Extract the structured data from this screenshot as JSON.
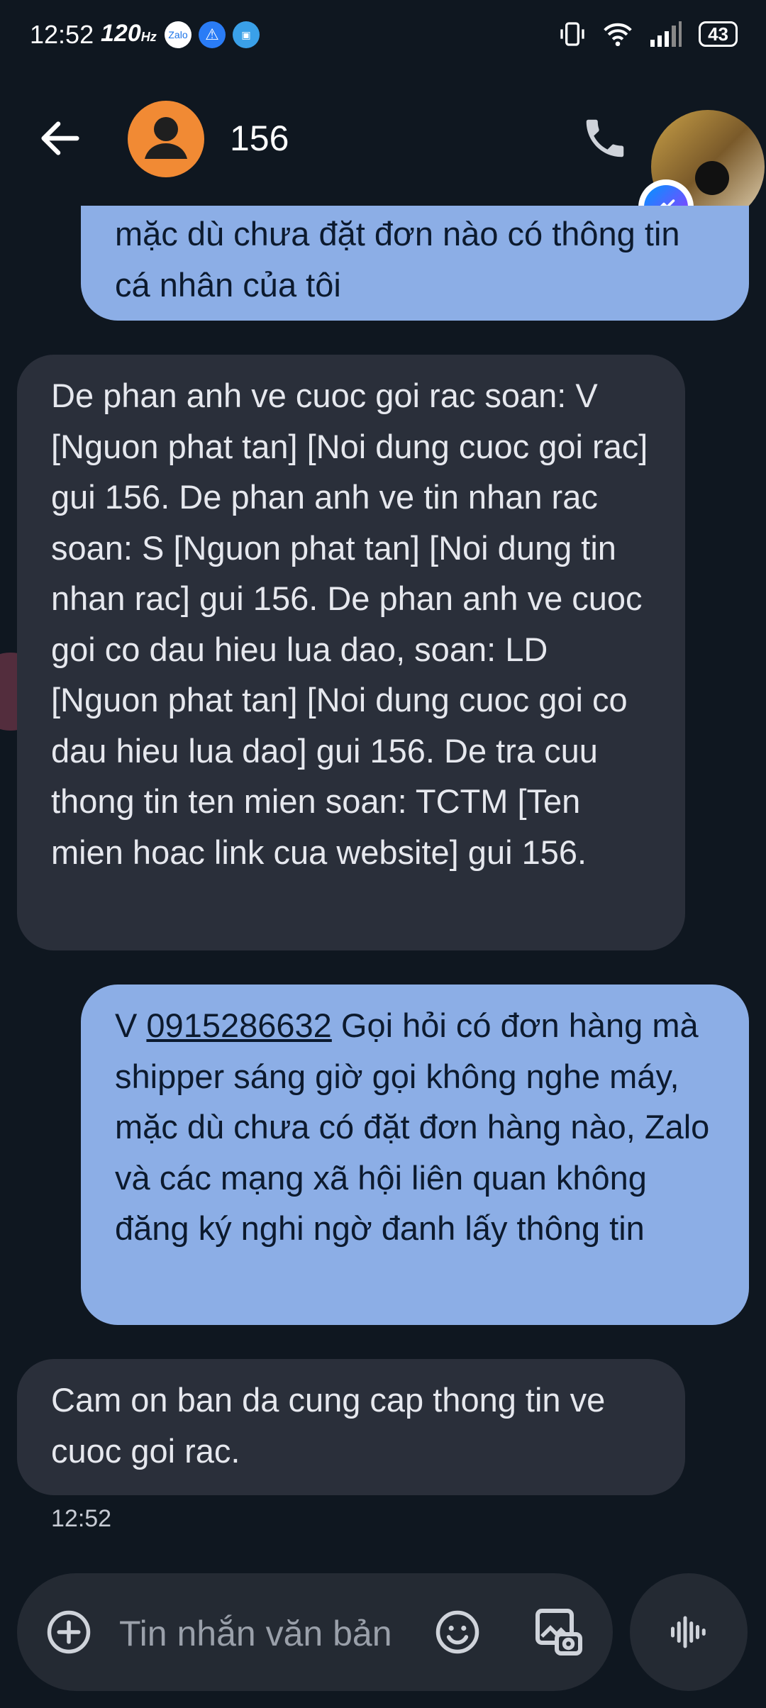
{
  "status_bar": {
    "time": "12:52",
    "refresh_rate": "120",
    "refresh_unit": "Hz",
    "notification_icons": [
      "zalopay-icon",
      "warning-icon",
      "app-icon"
    ],
    "battery": "43"
  },
  "header": {
    "contact_name": "156"
  },
  "messages": [
    {
      "direction": "outgoing",
      "text": "mặc dù chưa đặt đơn nào có thông tin cá nhân của tôi"
    },
    {
      "direction": "incoming",
      "text": "De phan anh ve cuoc goi rac soan: V [Nguon phat tan] [Noi dung cuoc goi rac] gui 156. De phan anh ve tin nhan rac soan: S [Nguon phat tan] [Noi dung tin nhan rac] gui 156. De phan anh ve cuoc goi co dau hieu lua dao, soan: LD [Nguon phat tan] [Noi dung cuoc goi co dau hieu lua dao] gui 156. De tra cuu thong tin ten mien soan: TCTM [Ten mien hoac link cua website] gui 156."
    },
    {
      "direction": "outgoing",
      "prefix": "V",
      "phone": "0915286632",
      "text": "Gọi hỏi có đơn hàng mà shipper sáng giờ gọi không nghe máy, mặc dù chưa có đặt đơn hàng nào, Zalo và các mạng xã hội liên quan không đăng ký nghi ngờ đanh lấy thông tin"
    },
    {
      "direction": "incoming",
      "text": "Cam on ban da cung cap thong tin ve cuoc goi rac."
    }
  ],
  "last_message_time": "12:52",
  "composer": {
    "placeholder": "Tin nhắn văn bản",
    "value": ""
  },
  "colors": {
    "background": "#0f1720",
    "outgoing_bubble": "#8caee6",
    "incoming_bubble": "#2a2f3a",
    "avatar": "#f18a34"
  }
}
